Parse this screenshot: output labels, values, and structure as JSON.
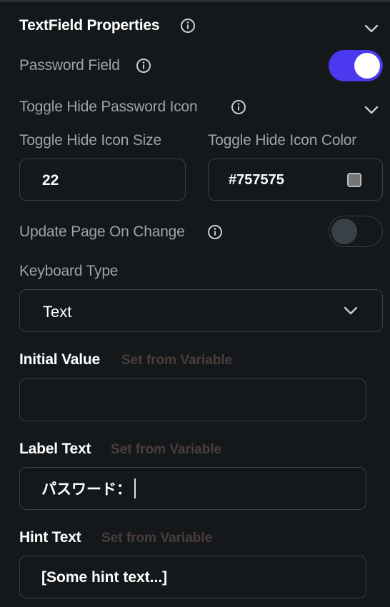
{
  "section": {
    "title": "TextField Properties"
  },
  "password_field": {
    "label": "Password Field",
    "enabled": true
  },
  "toggle_hide": {
    "label": "Toggle Hide Password Icon",
    "size_label": "Toggle Hide Icon Size",
    "size_value": "22",
    "color_label": "Toggle Hide Icon Color",
    "color_value": "#757575"
  },
  "update_page": {
    "label": "Update Page On Change",
    "enabled": false
  },
  "keyboard": {
    "label": "Keyboard Type",
    "selected": "Text"
  },
  "initial_value": {
    "label": "Initial Value",
    "var_link": "Set from Variable",
    "value": ""
  },
  "label_text": {
    "label": "Label Text",
    "var_link": "Set from Variable",
    "value": "パスワード："
  },
  "hint_text": {
    "label": "Hint Text",
    "var_link": "Set from Variable",
    "value": "[Some hint text...]"
  },
  "colors": {
    "background": "#14181b",
    "accent": "#4b39ef",
    "border": "#3a4047",
    "muted_text": "#9aa3aa",
    "var_link": "#4a3d3a"
  },
  "icons": [
    "info-icon",
    "chevron-down-icon",
    "color-swatch-icon"
  ]
}
